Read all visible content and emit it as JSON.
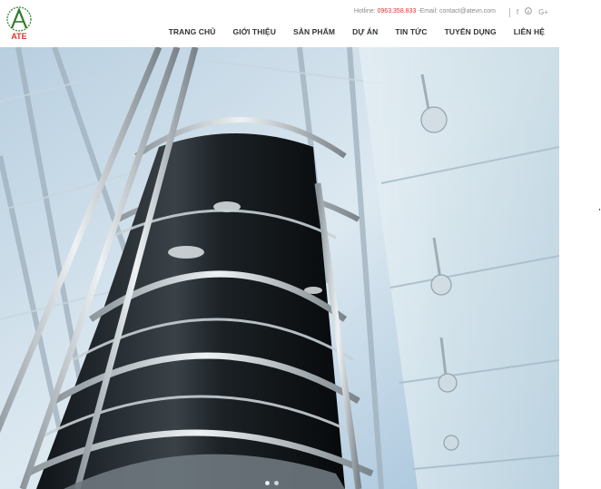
{
  "header": {
    "logo_text": "ATE",
    "hotline_label": "Hotline:",
    "hotline_number": "0963.358.833",
    "email_text": "-Email: contact@atevn.com",
    "social": [
      "facebook-icon",
      "skype-icon",
      "google-plus-icon"
    ]
  },
  "nav": {
    "items": [
      "TRANG CHỦ",
      "GIỚI THIỆU",
      "SẢN PHẨM",
      "DỰ ÁN",
      "TIN TỨC",
      "TUYỂN DỤNG",
      "LIÊN HỆ"
    ]
  },
  "slider": {
    "image": "glass-panoramic-elevator-photo",
    "total_slides": 2,
    "active_slide": 1
  },
  "colors": {
    "accent_red": "#e0322a",
    "logo_green": "#3a8a3a",
    "nav_text": "#333333"
  }
}
